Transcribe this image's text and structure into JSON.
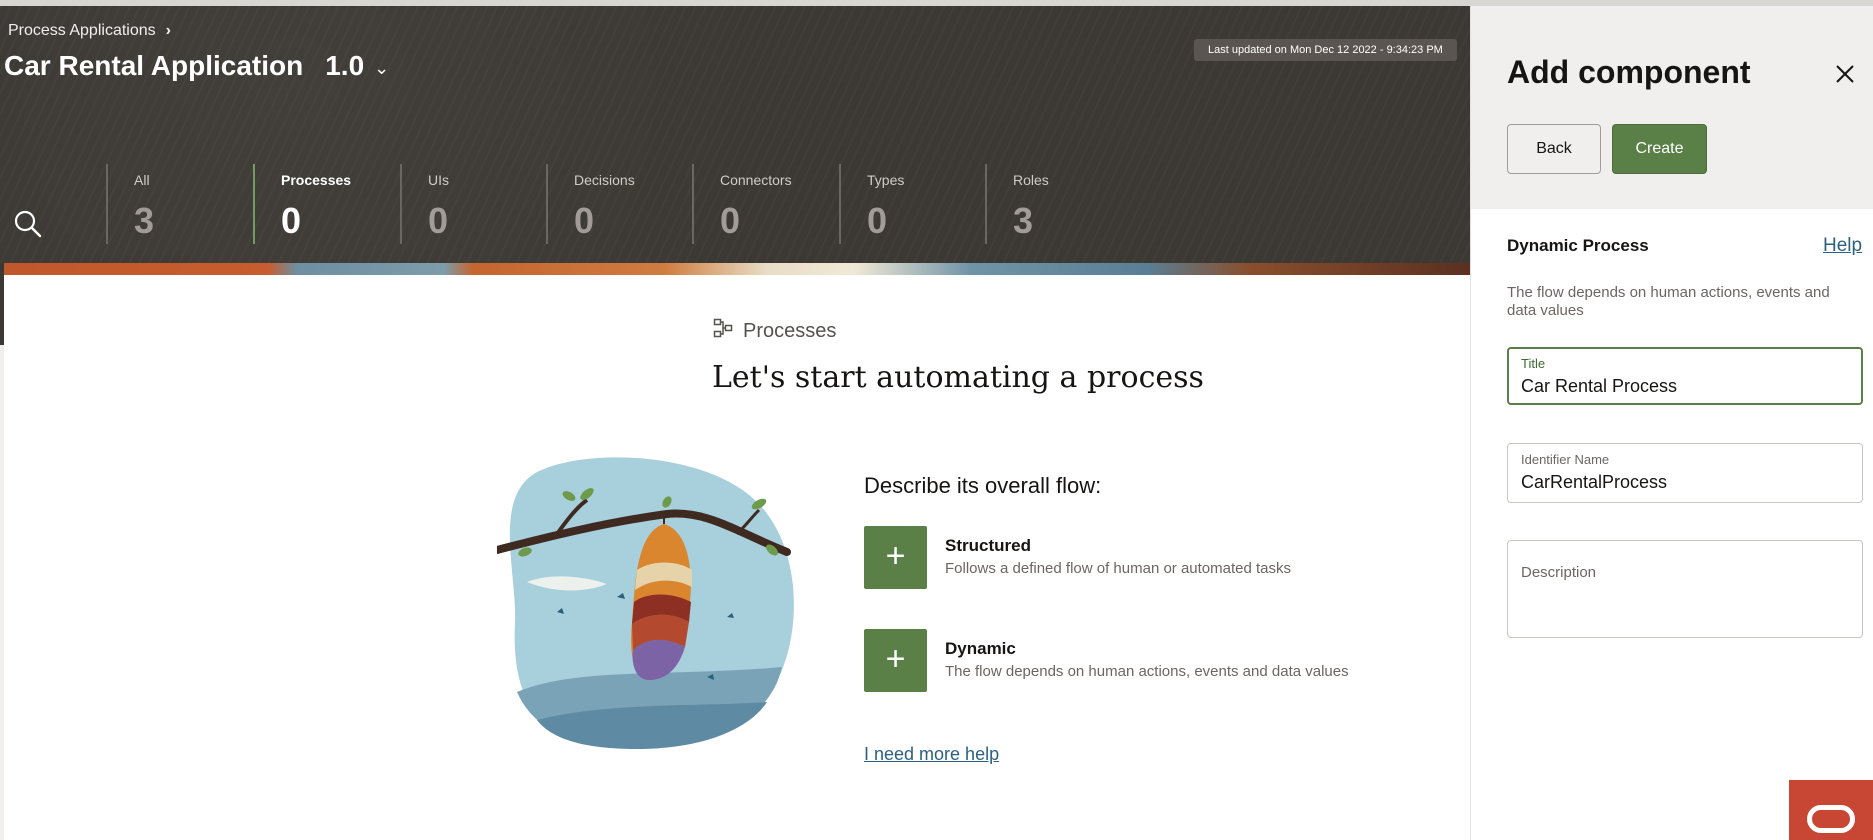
{
  "header": {
    "breadcrumb": "Process Applications",
    "app_name": "Car Rental Application",
    "version": "1.0",
    "last_updated": "Last updated on Mon Dec 12 2022 - 9:34:23 PM"
  },
  "stats": [
    {
      "label": "All",
      "count": "3"
    },
    {
      "label": "Processes",
      "count": "0"
    },
    {
      "label": "UIs",
      "count": "0"
    },
    {
      "label": "Decisions",
      "count": "0"
    },
    {
      "label": "Connectors",
      "count": "0"
    },
    {
      "label": "Types",
      "count": "0"
    },
    {
      "label": "Roles",
      "count": "3"
    }
  ],
  "main": {
    "section_label": "Processes",
    "headline": "Let's start automating a process",
    "describe_prompt": "Describe its overall flow:",
    "options": [
      {
        "title": "Structured",
        "description": "Follows a defined flow of human or automated tasks"
      },
      {
        "title": "Dynamic",
        "description": "The flow depends on human actions, events and data values"
      }
    ],
    "more_help": "I need more help"
  },
  "drawer": {
    "title": "Add component",
    "back_label": "Back",
    "create_label": "Create",
    "section_title": "Dynamic Process",
    "help_label": "Help",
    "section_description": "The flow depends on human actions, events and data values",
    "fields": {
      "title": {
        "label": "Title",
        "value": "Car Rental Process"
      },
      "identifier": {
        "label": "Identifier Name",
        "value": "CarRentalProcess"
      },
      "description": {
        "label": "Description",
        "value": ""
      }
    }
  },
  "icons": {
    "search": "search-icon",
    "close": "close-icon",
    "chevron": "chevron-right-icon",
    "caret": "chevron-down-icon",
    "process": "process-flow-icon",
    "plus": "plus-icon",
    "brand": "oracle-logo-icon"
  },
  "colors": {
    "header_bg": "#3c3833",
    "accent_green": "#5a8048",
    "link_blue": "#2c6182",
    "brand_red": "#c74634"
  }
}
